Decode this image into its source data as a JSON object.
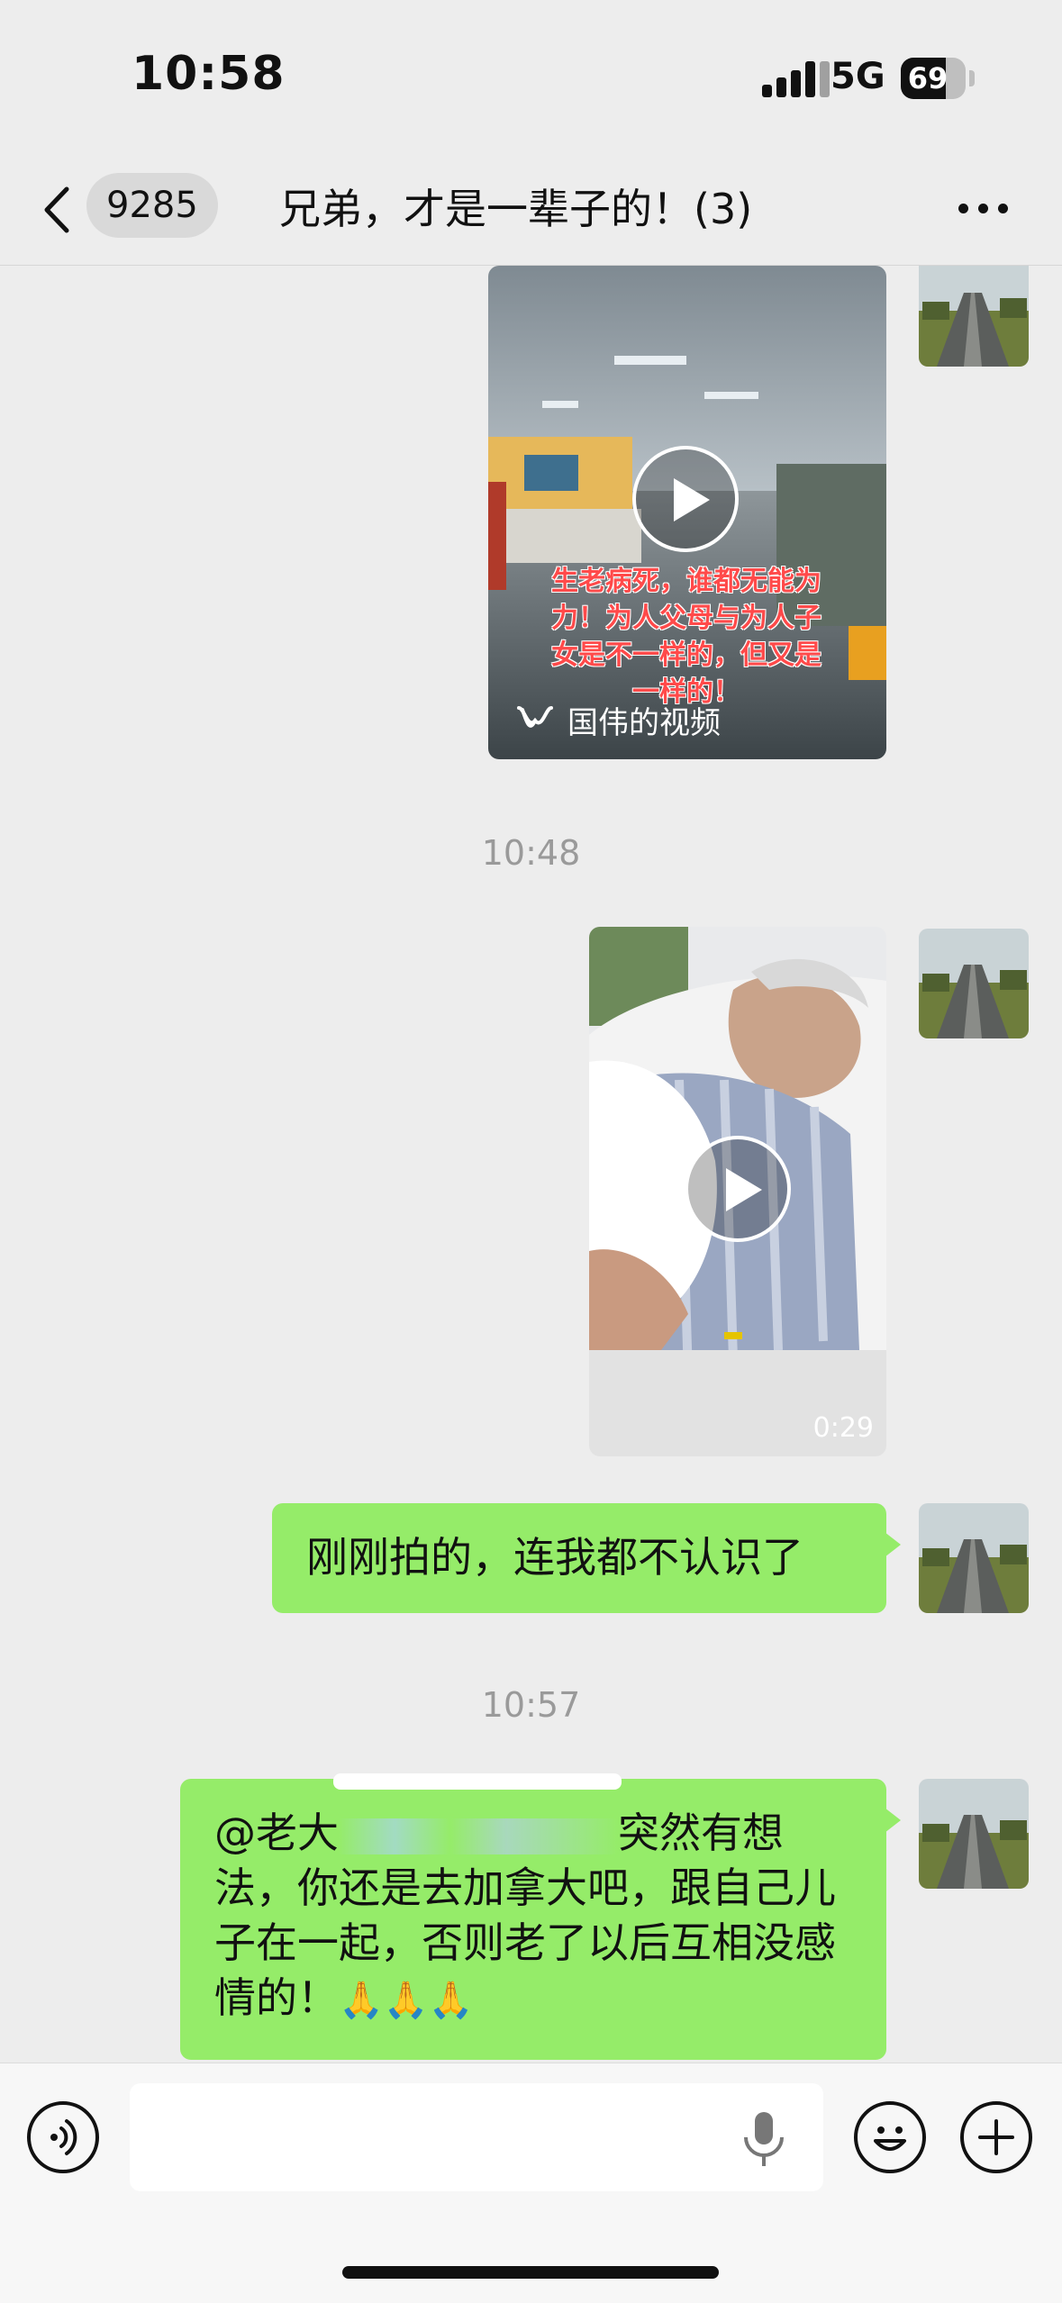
{
  "status_bar": {
    "time": "10:58",
    "network": "5G",
    "battery": "69",
    "battery_level": 0.69
  },
  "nav": {
    "unread_count": "9285",
    "title": "兄弟，才是一辈子的！(3)"
  },
  "messages": {
    "video1": {
      "caption": "生老病死，谁都无能为力！为人父母与为人子女是不一样的，但又是一样的！",
      "channel": "国伟的视频"
    },
    "time1": "10:48",
    "video2": {
      "duration": "0:29"
    },
    "text1": "刚刚拍的，连我都不认识了",
    "time2": "10:57",
    "text2": {
      "mention": "@老大",
      "part1": "突然有想法，你还是去加拿大吧，跟自己儿子在一起，否则老了以后互相没感情的！",
      "emojis": "🙏🙏🙏"
    }
  },
  "input": {
    "placeholder": ""
  },
  "colors": {
    "bubble": "#95ec69",
    "background": "#ededed",
    "timestamp": "#9a9a9a"
  },
  "icons": [
    "back-arrow-icon",
    "more-dots-icon",
    "play-icon",
    "wechat-channels-icon",
    "voice-icon",
    "mic-icon",
    "emoji-icon",
    "plus-icon"
  ]
}
